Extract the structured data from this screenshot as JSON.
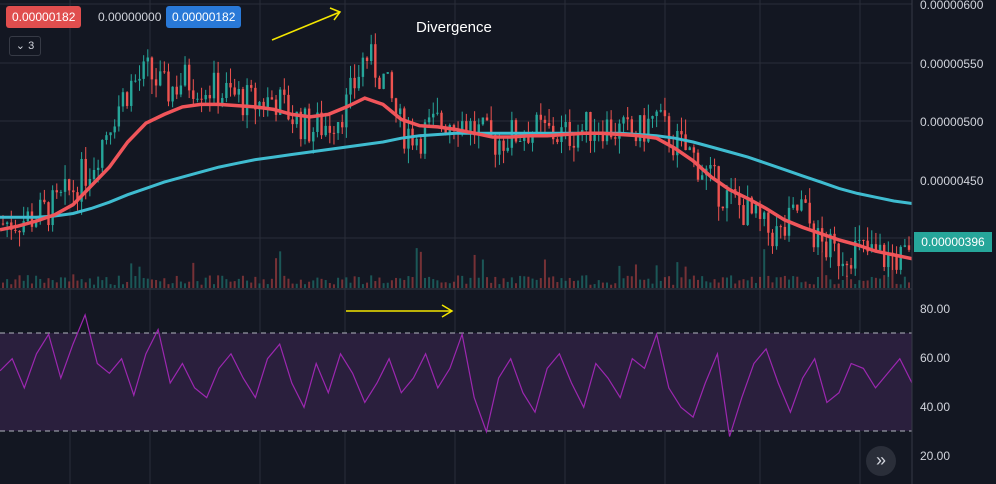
{
  "toolbar": {
    "bid_value": "0.00000182",
    "mid_value": "0.00000000",
    "ask_value": "0.00000182",
    "collapse_count": "3"
  },
  "annotation": {
    "divergence_label": "Divergence"
  },
  "price_axis": {
    "ticks": [
      "0.00000600",
      "0.00000550",
      "0.00000500",
      "0.00000450"
    ],
    "last_price_label": "0.00000396"
  },
  "rsi_axis": {
    "ticks": [
      "80.00",
      "60.00",
      "40.00",
      "20.00"
    ]
  },
  "colors": {
    "background": "#131722",
    "grid": "#2a2e39",
    "up": "#26a69a",
    "down": "#ef5350",
    "ma_fast": "#f0555a",
    "ma_slow": "#3fbcd0",
    "rsi_line": "#9c27b0",
    "rsi_band": "#2a1f3d",
    "arrow": "#f3e600",
    "tag": "#26a69a"
  },
  "icons": {
    "collapse": "chevron-down-icon",
    "scroll": "double-chevron-right-icon"
  },
  "chart_data": [
    {
      "type": "line",
      "subtype": "candlestick price with moving averages",
      "y_axis_range": [
        3.8e-06,
        6e-06
      ],
      "last_price": 3.96e-06,
      "series": [
        {
          "role": "price close",
          "values": [
            4.25e-06,
            4.28e-06,
            4.32e-06,
            4.4e-06,
            4.55e-06,
            4.75e-06,
            5.1e-06,
            5.35e-06,
            5.45e-06,
            5.3e-06,
            5.4e-06,
            5.35e-06,
            5.3e-06,
            5.25e-06,
            5.2e-06,
            5.25e-06,
            5.1e-06,
            5e-06,
            5.05e-06,
            5.2e-06,
            5.6e-06,
            5.4e-06,
            5e-06,
            4.95e-06,
            5.05e-06,
            5.1e-06,
            5e-06,
            4.9e-06,
            4.95e-06,
            5e-06,
            4.98e-06,
            4.95e-06,
            5e-06,
            5.05e-06,
            4.98e-06,
            4.95e-06,
            5.1e-06,
            4.9e-06,
            4.8e-06,
            4.6e-06,
            4.45e-06,
            4.35e-06,
            4.2e-06,
            4.15e-06,
            4.4e-06,
            4.1e-06,
            4e-06,
            4.05e-06,
            4e-06,
            3.98e-06,
            3.96e-06
          ]
        },
        {
          "role": "fast moving average",
          "values": [
            4.2e-06,
            4.23e-06,
            4.27e-06,
            4.32e-06,
            4.4e-06,
            4.55e-06,
            4.7e-06,
            4.9e-06,
            5.05e-06,
            5.12e-06,
            5.18e-06,
            5.2e-06,
            5.2e-06,
            5.19e-06,
            5.18e-06,
            5.16e-06,
            5.12e-06,
            5.1e-06,
            5.12e-06,
            5.18e-06,
            5.25e-06,
            5.2e-06,
            5.08e-06,
            5.03e-06,
            5.02e-06,
            5e-06,
            4.97e-06,
            4.94e-06,
            4.94e-06,
            4.95e-06,
            4.95e-06,
            4.96e-06,
            4.97e-06,
            4.97e-06,
            4.96e-06,
            4.95e-06,
            4.93e-06,
            4.85e-06,
            4.75e-06,
            4.62e-06,
            4.52e-06,
            4.45e-06,
            4.37e-06,
            4.28e-06,
            4.22e-06,
            4.17e-06,
            4.12e-06,
            4.08e-06,
            4.03e-06,
            4e-06,
            3.97e-06
          ]
        },
        {
          "role": "slow moving average",
          "values": [
            4.3e-06,
            4.3e-06,
            4.3e-06,
            4.31e-06,
            4.33e-06,
            4.37e-06,
            4.42e-06,
            4.48e-06,
            4.53e-06,
            4.58e-06,
            4.62e-06,
            4.66e-06,
            4.7e-06,
            4.73e-06,
            4.76e-06,
            4.78e-06,
            4.8e-06,
            4.82e-06,
            4.84e-06,
            4.86e-06,
            4.88e-06,
            4.9e-06,
            4.93e-06,
            4.95e-06,
            4.96e-06,
            4.97e-06,
            4.97e-06,
            4.97e-06,
            4.97e-06,
            4.97e-06,
            4.97e-06,
            4.97e-06,
            4.97e-06,
            4.97e-06,
            4.97e-06,
            4.96e-06,
            4.95e-06,
            4.93e-06,
            4.9e-06,
            4.86e-06,
            4.82e-06,
            4.78e-06,
            4.73e-06,
            4.68e-06,
            4.63e-06,
            4.58e-06,
            4.53e-06,
            4.49e-06,
            4.46e-06,
            4.43e-06,
            4.41e-06
          ]
        }
      ]
    },
    {
      "type": "line",
      "subtype": "oscillator",
      "y_axis_range": [
        15,
        85
      ],
      "band": [
        30,
        70
      ],
      "series": [
        {
          "role": "oscillator",
          "values": [
            55,
            60,
            48,
            62,
            70,
            52,
            66,
            78,
            58,
            54,
            60,
            45,
            62,
            72,
            50,
            58,
            48,
            44,
            56,
            62,
            52,
            44,
            60,
            66,
            50,
            40,
            58,
            46,
            62,
            54,
            42,
            50,
            60,
            46,
            52,
            62,
            48,
            56,
            70,
            44,
            30,
            52,
            60,
            46,
            38,
            56,
            62,
            50,
            40,
            58,
            52,
            44,
            60,
            56,
            70,
            48,
            40,
            36,
            50,
            62,
            28,
            44,
            58,
            64,
            50,
            38,
            52,
            60,
            42,
            46,
            58,
            56,
            48,
            54,
            60,
            50
          ]
        }
      ]
    }
  ]
}
